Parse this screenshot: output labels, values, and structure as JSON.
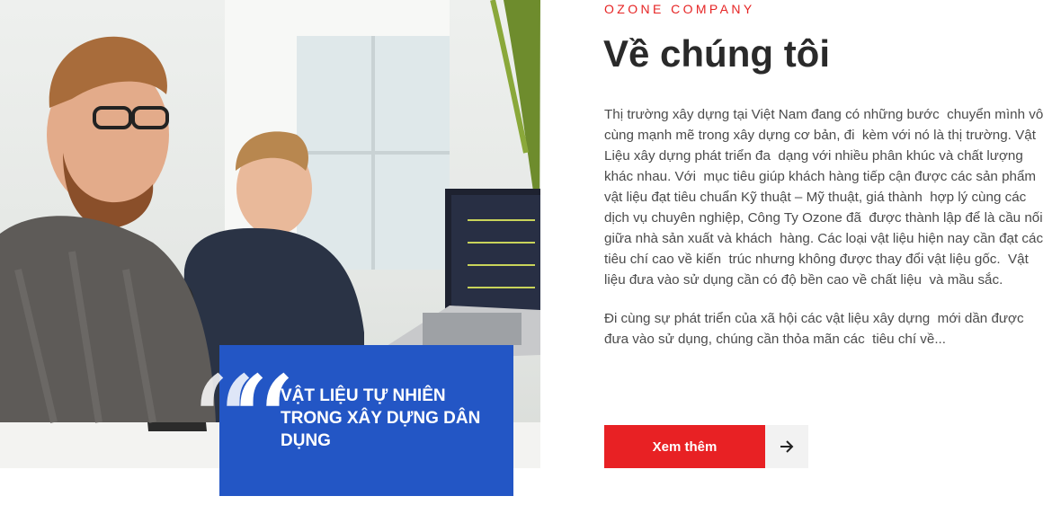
{
  "photo": {
    "icon": "office-photo"
  },
  "quote_card": {
    "title": "VẬT LIỆU TỰ NHIÊN TRONG XÂY DỰNG DÂN DỤNG",
    "quote_mark": "“",
    "color": "#2356c5"
  },
  "about": {
    "eyebrow": "OZONE COMPANY",
    "heading": "Về chúng tôi",
    "paragraph_1": "Thị trường xây dựng tại Việt Nam đang có những bước  chuyển mình vô cùng mạnh mẽ trong xây dựng cơ bản, đi  kèm với nó là thị trường. Vật Liệu xây dựng phát triển đa  dạng với nhiều phân khúc và chất lượng khác nhau. Với  mục tiêu giúp khách hàng tiếp cận được các sản phẩm  vật liệu đạt tiêu chuẩn Kỹ thuật – Mỹ thuật, giá thành  hợp lý cùng các dịch vụ chuyên nghiệp, Công Ty Ozone đã  được thành lập để là cầu nối giữa nhà sản xuất và khách  hàng. Các loại vật liệu hiện nay cần đạt các tiêu chí cao về kiến  trúc nhưng không được thay đổi vật liệu gốc.  Vật liệu đưa vào sử dụng cần có độ bền cao về chất liệu  và mầu sắc.",
    "paragraph_2": "Đi cùng sự phát triển của xã hội các vật liệu xây dựng  mới dần được đưa vào sử dụng, chúng cần thỏa mãn các  tiêu chí về...",
    "cta_label": "Xem thêm",
    "cta_icon": "arrow-right-icon",
    "accent": "#e82124"
  }
}
